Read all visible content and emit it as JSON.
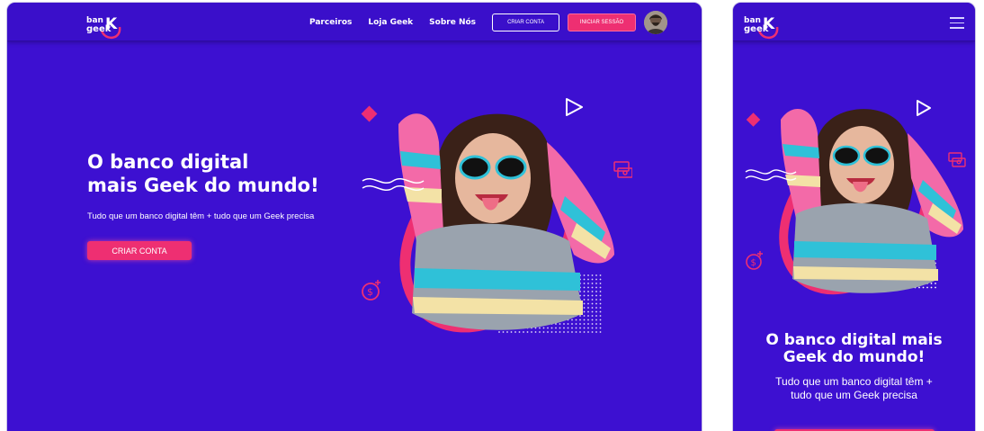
{
  "brand": {
    "logo_text_top": "ban",
    "logo_text_bottom": "geek",
    "logo_mark": "K"
  },
  "desktop": {
    "nav": {
      "links": [
        "Parceiros",
        "Loja Geek",
        "Sobre Nós"
      ],
      "create_account_label": "CRIAR CONTA",
      "login_label": "INICIAR SESSÃO"
    },
    "hero": {
      "title_line1": "O banco digital",
      "title_line2": "mais Geek do mundo!",
      "subtitle": "Tudo que um banco digital têm + tudo que um Geek precisa",
      "cta_label": "CRIAR CONTA"
    }
  },
  "mobile": {
    "hero": {
      "title_line1": "O banco digital mais",
      "title_line2": "Geek do mundo!",
      "subtitle_line1": "Tudo que um banco digital têm +",
      "subtitle_line2": "tudo que um Geek precisa"
    }
  },
  "icons": [
    "logo-icon",
    "avatar",
    "play-icon",
    "diamond-icon",
    "money-icon",
    "dollar-coin-icon",
    "wave-lines",
    "dot-grid",
    "hamburger-menu-icon"
  ],
  "colors": {
    "background": "#3d10d1",
    "accent_pink": "#ee2f72",
    "text": "#ffffff"
  }
}
